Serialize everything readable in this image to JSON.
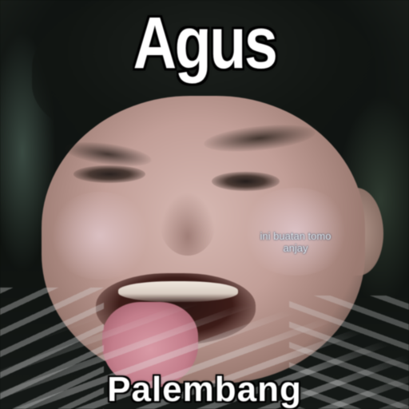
{
  "meme": {
    "top_caption": "Agus",
    "bottom_caption": "Palembang",
    "watermark_line1": "ini buatan tomo",
    "watermark_line2": "anjay"
  }
}
